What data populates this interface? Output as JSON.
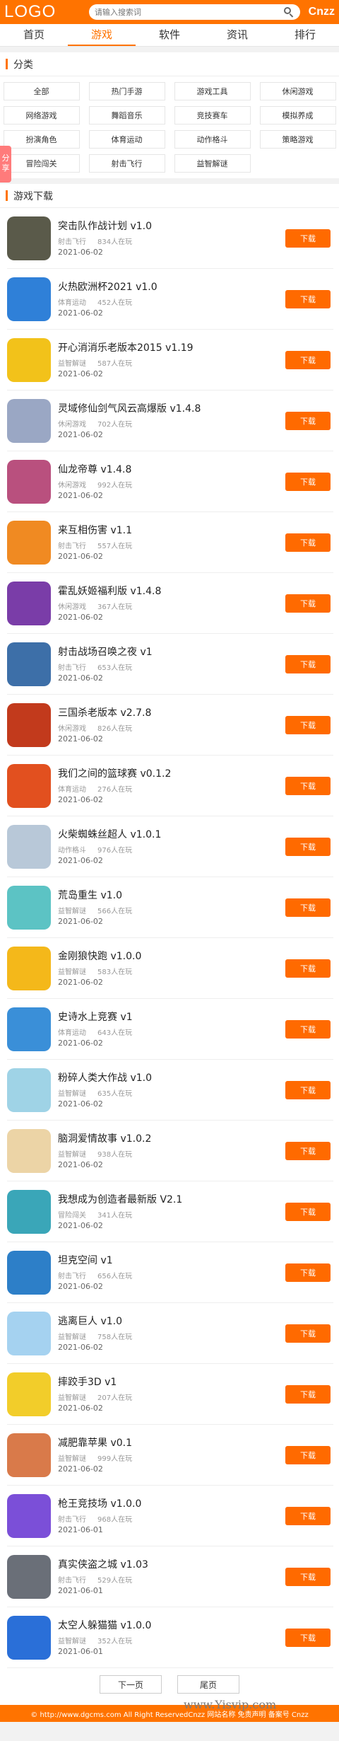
{
  "header": {
    "logo": "LOGO",
    "search_placeholder": "请输入搜索词",
    "brand": "Cnzz"
  },
  "nav": [
    "首页",
    "游戏",
    "软件",
    "资讯",
    "排行"
  ],
  "categories_section": {
    "title": "分类",
    "share_label": "分享",
    "items": [
      "全部",
      "热门手游",
      "游戏工具",
      "休闲游戏",
      "网络游戏",
      "舞蹈音乐",
      "竞技赛车",
      "模拟养成",
      "扮演角色",
      "体育运动",
      "动作格斗",
      "策略游戏",
      "冒险闯关",
      "射击飞行",
      "益智解谜"
    ]
  },
  "games_section": {
    "title": "游戏下载",
    "download_label": "下载",
    "games": [
      {
        "name": "突击队作战计划 v1.0",
        "category": "射击飞行",
        "players": "834人在玩",
        "date": "2021-06-02",
        "color": "#5a5a4a"
      },
      {
        "name": "火热欧洲杯2021 v1.0",
        "category": "体育运动",
        "players": "452人在玩",
        "date": "2021-06-02",
        "color": "#2f80d8"
      },
      {
        "name": "开心消消乐老版本2015 v1.19",
        "category": "益智解谜",
        "players": "587人在玩",
        "date": "2021-06-02",
        "color": "#f2c21a"
      },
      {
        "name": "灵域修仙剑气风云高爆版 v1.4.8",
        "category": "休闲游戏",
        "players": "702人在玩",
        "date": "2021-06-02",
        "color": "#9aa7c4"
      },
      {
        "name": "仙龙帝尊 v1.4.8",
        "category": "休闲游戏",
        "players": "992人在玩",
        "date": "2021-06-02",
        "color": "#b9507e"
      },
      {
        "name": "来互相伤害 v1.1",
        "category": "射击飞行",
        "players": "557人在玩",
        "date": "2021-06-02",
        "color": "#f08a22"
      },
      {
        "name": "霍乱妖姬福利版 v1.4.8",
        "category": "休闲游戏",
        "players": "367人在玩",
        "date": "2021-06-02",
        "color": "#7a3da8"
      },
      {
        "name": "射击战场召唤之夜 v1",
        "category": "射击飞行",
        "players": "653人在玩",
        "date": "2021-06-02",
        "color": "#3d6fa8"
      },
      {
        "name": "三国杀老版本 v2.7.8",
        "category": "休闲游戏",
        "players": "826人在玩",
        "date": "2021-06-02",
        "color": "#c23a1c"
      },
      {
        "name": "我们之间的篮球赛 v0.1.2",
        "category": "体育运动",
        "players": "276人在玩",
        "date": "2021-06-02",
        "color": "#e2501f"
      },
      {
        "name": "火柴蜘蛛丝超人 v1.0.1",
        "category": "动作格斗",
        "players": "976人在玩",
        "date": "2021-06-02",
        "color": "#b8c8d8"
      },
      {
        "name": "荒岛重生 v1.0",
        "category": "益智解谜",
        "players": "566人在玩",
        "date": "2021-06-02",
        "color": "#5cc3c4"
      },
      {
        "name": "金刚狼快跑 v1.0.0",
        "category": "益智解谜",
        "players": "583人在玩",
        "date": "2021-06-02",
        "color": "#f4b81a"
      },
      {
        "name": "史诗水上竞赛 v1",
        "category": "体育运动",
        "players": "643人在玩",
        "date": "2021-06-02",
        "color": "#3a8fd8"
      },
      {
        "name": "粉碎人类大作战 v1.0",
        "category": "益智解谜",
        "players": "635人在玩",
        "date": "2021-06-02",
        "color": "#9fd3e6"
      },
      {
        "name": "脑洞爱情故事 v1.0.2",
        "category": "益智解谜",
        "players": "938人在玩",
        "date": "2021-06-02",
        "color": "#ecd4a6"
      },
      {
        "name": "我想成为创造者最新版 V2.1",
        "category": "冒险闯关",
        "players": "341人在玩",
        "date": "2021-06-02",
        "color": "#3aa6b8"
      },
      {
        "name": "坦克空间 v1",
        "category": "射击飞行",
        "players": "656人在玩",
        "date": "2021-06-02",
        "color": "#2d7fc8"
      },
      {
        "name": "逃离巨人 v1.0",
        "category": "益智解谜",
        "players": "758人在玩",
        "date": "2021-06-02",
        "color": "#a5d2f0"
      },
      {
        "name": "摔跤手3D v1",
        "category": "益智解谜",
        "players": "207人在玩",
        "date": "2021-06-02",
        "color": "#f2cd2a"
      },
      {
        "name": "减肥靠苹果 v0.1",
        "category": "益智解谜",
        "players": "999人在玩",
        "date": "2021-06-02",
        "color": "#d97a4a"
      },
      {
        "name": "枪王竞技场 v1.0.0",
        "category": "射击飞行",
        "players": "968人在玩",
        "date": "2021-06-01",
        "color": "#7b4fd8"
      },
      {
        "name": "真实侠盗之城 v1.03",
        "category": "射击飞行",
        "players": "529人在玩",
        "date": "2021-06-01",
        "color": "#6a6f78"
      },
      {
        "name": "太空人躲猫猫 v1.0.0",
        "category": "益智解谜",
        "players": "352人在玩",
        "date": "2021-06-01",
        "color": "#2a6fd8"
      }
    ]
  },
  "pager": {
    "next": "下一页",
    "last": "尾页"
  },
  "footer": {
    "text": "© http://www.dgcms.com All Right ReservedCnzz 网站名称 免责声明 备案号 Cnzz"
  },
  "watermark": "www.Yisvip.com"
}
